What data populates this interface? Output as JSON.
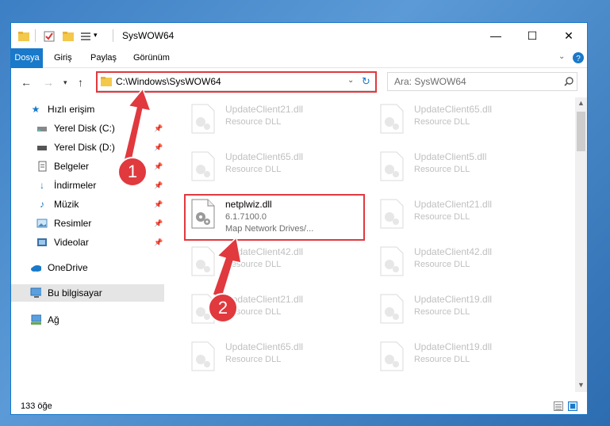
{
  "titlebar": {
    "title": "SysWOW64",
    "minimize": "—",
    "maximize": "☐",
    "close": "✕"
  },
  "ribbon": {
    "tabs": [
      "Dosya",
      "Giriş",
      "Paylaş",
      "Görünüm"
    ]
  },
  "navbar": {
    "address": "C:\\Windows\\SysWOW64",
    "search_placeholder": "Ara: SysWOW64"
  },
  "sidebar": {
    "items": [
      {
        "label": "Hızlı erişim",
        "icon": "star-icon"
      },
      {
        "label": "Yerel Disk (C:)",
        "icon": "drive-icon"
      },
      {
        "label": "Yerel Disk (D:)",
        "icon": "drive-icon"
      },
      {
        "label": "Belgeler",
        "icon": "documents-icon"
      },
      {
        "label": "İndirmeler",
        "icon": "download-icon"
      },
      {
        "label": "Müzik",
        "icon": "music-icon"
      },
      {
        "label": "Resimler",
        "icon": "pictures-icon"
      },
      {
        "label": "Videolar",
        "icon": "video-icon"
      },
      {
        "label": "OneDrive",
        "icon": "cloud-icon"
      },
      {
        "label": "Bu bilgisayar",
        "icon": "computer-icon"
      },
      {
        "label": "Ağ",
        "icon": "network-icon"
      }
    ]
  },
  "files": {
    "left": [
      {
        "name": "UpdateClient21.dll",
        "sub": "Resource DLL"
      },
      {
        "name": "UpdateClient65.dll",
        "sub": "Resource DLL"
      },
      {
        "name": "UpdateClient42.dll",
        "sub": "Resource DLL"
      },
      {
        "name": "UpdateClient21.dll",
        "sub": "Resource DLL"
      },
      {
        "name": "UpdateClient65.dll",
        "sub": "Resource DLL"
      }
    ],
    "right": [
      {
        "name": "UpdateClient65.dll",
        "sub": "Resource DLL"
      },
      {
        "name": "UpdateClient5.dll",
        "sub": "Resource DLL"
      },
      {
        "name": "UpdateClient21.dll",
        "sub": "Resource DLL"
      },
      {
        "name": "UpdateClient42.dll",
        "sub": "Resource DLL"
      },
      {
        "name": "UpdateClient19.dll",
        "sub": "Resource DLL"
      },
      {
        "name": "UpdateClient19.dll",
        "sub": "Resource DLL"
      }
    ],
    "selected": {
      "name": "netplwiz.dll",
      "version": "6.1.7100.0",
      "desc": "Map Network Drives/..."
    }
  },
  "status": {
    "count": "133 öğe"
  },
  "annotations": {
    "step1": "1",
    "step2": "2"
  },
  "colors": {
    "accent": "#1979ca",
    "highlight": "#e0393e"
  }
}
